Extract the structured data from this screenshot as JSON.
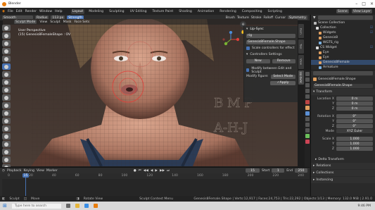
{
  "window": {
    "title": "Blender"
  },
  "menubar": {
    "menus": [
      "File",
      "Edit",
      "Render",
      "Window",
      "Help"
    ],
    "workspace_tabs": [
      "Layout",
      "Modeling",
      "Sculpting",
      "UV Editing",
      "Texture Paint",
      "Shading",
      "Animation",
      "Rendering",
      "Compositing",
      "Scripting"
    ],
    "active_tab": "Layout",
    "scene": "Scene",
    "view_layer": "View Layer"
  },
  "tool_header": {
    "brush": "Smooth",
    "mode_btn": "Radius",
    "radius": "113 px",
    "strength_label": "Strength",
    "options": [
      "Brush",
      "Texture",
      "Stroke",
      "Falloff",
      "Cursor"
    ],
    "symmetry": "Symmetry"
  },
  "viewport_header": {
    "mode": "Sculpt Mode",
    "menus": [
      "View",
      "Sculpt",
      "Mask",
      "Face Sets"
    ]
  },
  "viewport": {
    "overlay_title": "User Perspective",
    "overlay_object": "(15) Genesis8FemaleShape : OV",
    "bg_color": "#2a2320"
  },
  "npanel": {
    "section": "Lip-Sync",
    "rig_field": "rig",
    "shape_field": "Genesis8Female.Shape",
    "option_scale": "Scale controllers for effect",
    "section_controllers": "Controllers Settings",
    "btn_new": "New",
    "btn_remove": "Remove",
    "option_modify": "Modify between Edit and Sculpt",
    "modify_label": "Modify figure:",
    "modify_value": "Select Mode",
    "apply_btn": "Apply"
  },
  "side_tabs": [
    "Item",
    "Tool",
    "View",
    "Lip-Sync"
  ],
  "outliner": {
    "title": "Scene Collection",
    "rows": [
      {
        "label": "Collection",
        "color": "#e0e0e0"
      },
      {
        "label": "Widgets",
        "color": "#bdbdbd"
      },
      {
        "label": "Genesis8",
        "color": "#bdbdbd"
      },
      {
        "label": "WGTS_rig",
        "color": "#bdbdbd"
      },
      {
        "label": "CS Widget",
        "color": "#bdbdbd"
      },
      {
        "label": "Eye",
        "color": "#bdbdbd"
      },
      {
        "label": "Eye",
        "color": "#bdbdbd"
      },
      {
        "label": "Genesis8Female",
        "color": "#bdbdbd"
      },
      {
        "label": "Armature",
        "color": "#bdbdbd"
      }
    ]
  },
  "properties": {
    "object_name": "Genesis8Female.Shape",
    "object_field": "Genesis8Female.Shape",
    "section_transform": "Transform",
    "location_label": "Location X",
    "loc": [
      "0 m",
      "0 m",
      "0 m"
    ],
    "rotation_label": "Rotation X",
    "rot": [
      "0°",
      "0°",
      "0°"
    ],
    "mode_label": "Mode",
    "mode_value": "XYZ Euler",
    "scale_label": "Scale X",
    "scale": [
      "1.000",
      "1.000",
      "1.000"
    ],
    "y_label": "Y",
    "z_label": "Z",
    "section_delta": "Delta Transform",
    "section_relations": "Relations",
    "section_collections": "Collections",
    "section_instancing": "Instancing"
  },
  "timeline": {
    "menus": [
      "Playback",
      "Keying",
      "View",
      "Marker"
    ],
    "current_frame": "15",
    "start_label": "Start",
    "start": "1",
    "end_label": "End",
    "end": "250",
    "ticks": [
      "0",
      "20",
      "40",
      "60",
      "80",
      "100",
      "120",
      "140",
      "160",
      "180",
      "200",
      "220",
      "240"
    ]
  },
  "statusbar": {
    "left": "Sculpt",
    "middle": "Move",
    "rotate": "Rotate View",
    "context": "Sculpt Context Menu",
    "stats": "Genesis8Female.Shape | Verts:12,917 | Faces:24,753 | Tris:22,292 | Objects:1/13 | Memory: 132.0 MiB | 2.91.0"
  },
  "taskbar": {
    "search": "Type here to search",
    "time": "9:46 PM"
  }
}
